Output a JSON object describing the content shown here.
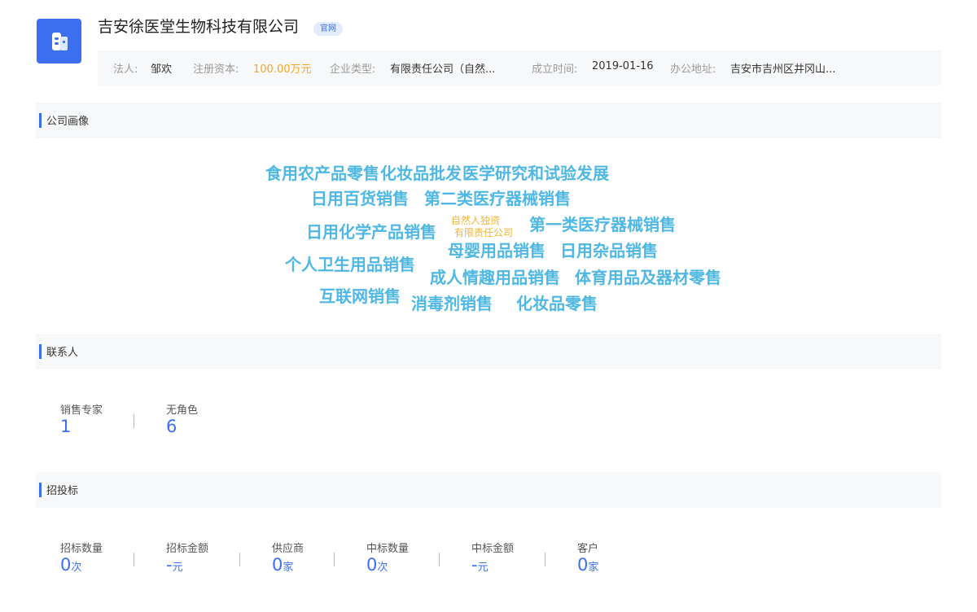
{
  "company": {
    "name": "吉安徐医堂生物科技有限公司",
    "official_tag": "官网",
    "logo_icon": "building-icon",
    "brand_color": "#3b6ff0"
  },
  "info": {
    "legal_label": "法人:",
    "legal_value": "邹欢",
    "capital_label": "注册资本:",
    "capital_value": "100.00万元",
    "type_label": "企业类型:",
    "type_value": "有限责任公司（自然...",
    "founded_label": "成立时间:",
    "founded_value": "2019-01-16",
    "address_label": "办公地址:",
    "address_value": "吉安市吉州区井冈山..."
  },
  "portrait": {
    "title": "公司画像",
    "words": [
      "食用农产品零售",
      "化妆品批发",
      "医学研究和试验发展",
      "日用百货销售",
      "第二类医疗器械销售",
      "日用化学产品销售",
      "自然人独资",
      "有限责任公司",
      "第一类医疗器械销售",
      "母婴用品销售",
      "日用杂品销售",
      "个人卫生用品销售",
      "成人情趣用品销售",
      "体育用品及器材零售",
      "互联网销售",
      "消毒剂销售",
      "化妆品零售"
    ]
  },
  "contacts": {
    "title": "联系人",
    "stats": [
      {
        "label": "销售专家",
        "value": "1"
      },
      {
        "label": "无角色",
        "value": "6"
      }
    ]
  },
  "bidding": {
    "title": "招投标",
    "stats": [
      {
        "label": "招标数量",
        "value": "0",
        "unit": "次"
      },
      {
        "label": "招标金额",
        "value": "-",
        "unit": "元"
      },
      {
        "label": "供应商",
        "value": "0",
        "unit": "家"
      },
      {
        "label": "中标数量",
        "value": "0",
        "unit": "次"
      },
      {
        "label": "中标金额",
        "value": "-",
        "unit": "元"
      },
      {
        "label": "客户",
        "value": "0",
        "unit": "家"
      }
    ]
  }
}
